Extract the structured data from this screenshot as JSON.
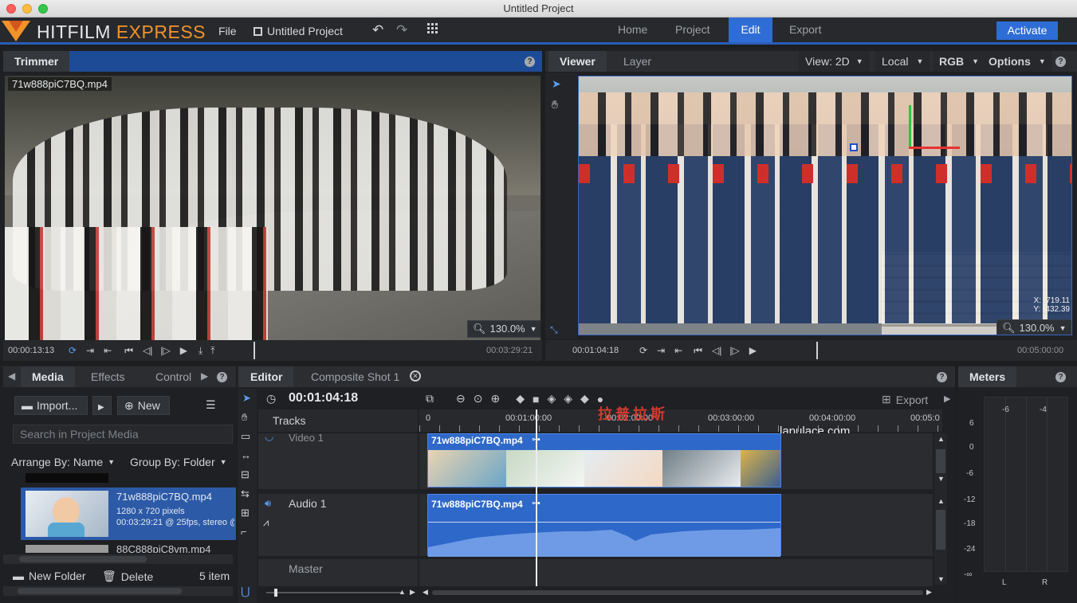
{
  "window": {
    "title": "Untitled Project"
  },
  "app": {
    "logo_main": "HITFILM ",
    "logo_accent": "EXPRESS",
    "menu": {
      "file": "File",
      "project_name": "Untitled Project"
    },
    "nav": [
      "Home",
      "Project",
      "Edit",
      "Export"
    ],
    "active_nav": "Edit",
    "activate_label": "Activate"
  },
  "trimmer": {
    "tab": "Trimmer",
    "clip_name": "71w888piC7BQ.mp4",
    "zoom": "130.0%",
    "current_time": "00:00:13:13",
    "duration": "00:03:29:21"
  },
  "viewer": {
    "tabs": [
      "Viewer",
      "Layer"
    ],
    "view_mode": "View: 2D",
    "space": "Local",
    "channel": "RGB",
    "options": "Options",
    "zoom": "130.0%",
    "coord_x": "X:    -719.11",
    "coord_y": "Y:    -432.39",
    "current_time": "00:01:04:18",
    "duration": "00:05:00:00"
  },
  "media": {
    "tabs": [
      "Media",
      "Effects",
      "Control"
    ],
    "import_label": "Import...",
    "new_label": "New",
    "search_placeholder": "Search in Project Media",
    "arrange_by": "Arrange By: Name",
    "group_by": "Group By: Folder",
    "items": [
      {
        "name": "71w888piC7BQ.mp4",
        "resolution": "1280 x 720 pixels",
        "details": "00:03:29:21 @ 25fps, stereo @"
      },
      {
        "name": "88C888piC8vm.mp4"
      }
    ],
    "new_folder": "New Folder",
    "delete": "Delete",
    "count": "5 item"
  },
  "editor": {
    "tabs": [
      "Editor",
      "Composite Shot 1"
    ],
    "timecode": "00:01:04:18",
    "export_label": "Export",
    "tracks_header": "Tracks",
    "video_track": "Video 1",
    "audio_track": "Audio 1",
    "master_track": "Master",
    "ruler": [
      "0",
      "00:01:00:00",
      "00:02:00:00",
      "00:03:00:00",
      "00:04:00:00",
      "00:05:0"
    ],
    "video_clip": "71w888piC7BQ.mp4",
    "audio_clip": "71w888piC7BQ.mp4",
    "watermark_cn": "拉普拉斯",
    "watermark_url": "lapulace.com"
  },
  "meters": {
    "tab": "Meters",
    "top_labels": [
      "-6",
      "-4"
    ],
    "scale": [
      "6",
      "0",
      "-6",
      "-12",
      "-18",
      "-24",
      "-∞"
    ],
    "channels": [
      "L",
      "R"
    ]
  },
  "colors": {
    "accent": "#2f6dd6",
    "logo_orange": "#f2932a",
    "panel": "#2b2d31",
    "clip": "#2e68c9"
  }
}
